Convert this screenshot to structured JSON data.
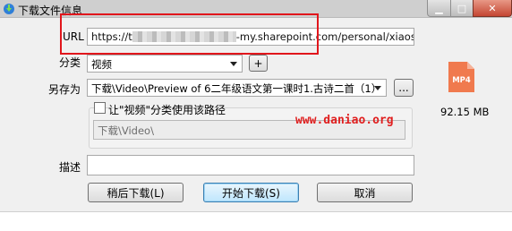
{
  "window": {
    "title": "下载文件信息",
    "min_glyph": "▁",
    "max_glyph": "□",
    "close_glyph": "✕"
  },
  "url": {
    "label": "URL",
    "value_prefix": "https://t",
    "value_suffix": "-my.sharepoint.com/personal/xiaoshitou_o"
  },
  "category": {
    "label": "分类",
    "value": "视频",
    "add_label": "+"
  },
  "save_as": {
    "label": "另存为",
    "value": "下载\\Video\\Preview of 6二年级语文第一课时1.古诗二首（1）",
    "browse_label": "..."
  },
  "use_path": {
    "label": "让\"视频\"分类使用该路径",
    "checked": false,
    "path_value": "下载\\Video\\"
  },
  "description": {
    "label": "描述",
    "value": ""
  },
  "buttons": {
    "later": "稍后下载(L)",
    "start": "开始下载(S)",
    "cancel": "取消"
  },
  "file": {
    "type_icon": "mp4-file-icon",
    "type_text": "MP4",
    "size": "92.15  MB"
  },
  "watermark": "www.daniao.org",
  "colors": {
    "highlight_box": "#e1161c",
    "watermark": "#e02020",
    "file_icon": "#f07a4e"
  }
}
